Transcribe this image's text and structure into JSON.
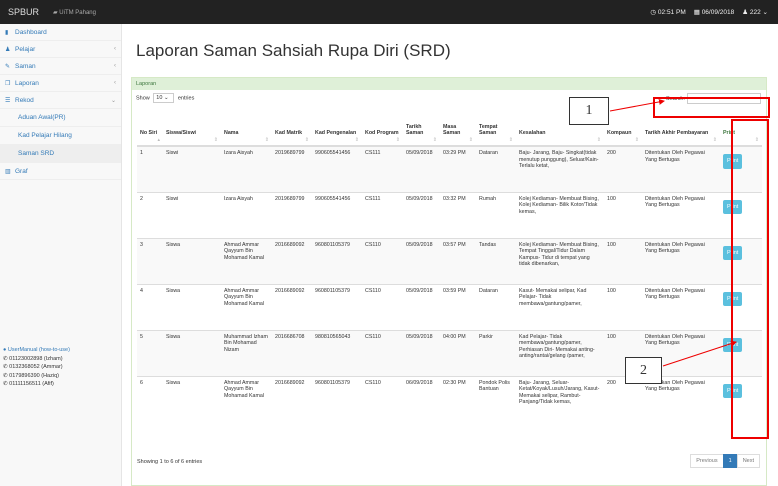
{
  "topbar": {
    "brand": "SPBUR",
    "sub": "UiTM Pahang",
    "time": "02:51 PM",
    "date": "06/09/2018",
    "user": "222"
  },
  "sidebar": {
    "items": [
      {
        "label": "Dashboard",
        "icon": "bookmark-icon",
        "chev": ""
      },
      {
        "label": "Pelajar",
        "icon": "users-icon",
        "chev": "‹"
      },
      {
        "label": "Saman",
        "icon": "edit-icon",
        "chev": "‹"
      },
      {
        "label": "Laporan",
        "icon": "copy-icon",
        "chev": "‹"
      },
      {
        "label": "Rekod",
        "icon": "list-icon",
        "chev": "⌄"
      }
    ],
    "subitems": [
      "Aduan Awal(PR)",
      "Kad Pelajar Hilang",
      "Saman SRD"
    ],
    "graf": "Graf"
  },
  "help": {
    "manual": "UserManual (how-to-use)",
    "contacts": [
      "01123002898 (Izham)",
      "0132368052 (Ammar)",
      "0179896390 (Haziq)",
      "01111156511 (Afif)"
    ]
  },
  "page": {
    "title": "Laporan Saman Sahsiah Rupa Diri (SRD)",
    "panel": "Laporan",
    "show": "Show",
    "entries_sel": "10",
    "entries": "entries",
    "search": "Search:",
    "info": "Showing 1 to 6 of 6 entries",
    "prev": "Previous",
    "page_no": "1",
    "next": "Next"
  },
  "table": {
    "headers": [
      "No Siri",
      "Siswa/Siswi",
      "Nama",
      "Kad Matrik",
      "Kad Pengenalan",
      "Kod Program",
      "Tarikh Saman",
      "Masa Saman",
      "Tempat Saman",
      "Kesalahan",
      "Kompaun",
      "Tarikh Akhir Pembayaran",
      "Print"
    ],
    "rows": [
      [
        "1",
        "Siswi",
        "Izara Aisyah",
        "2019689799",
        "990605541456",
        "CS111",
        "05/09/2018",
        "03:29 PM",
        "Dataran",
        "Baju- Jarang, Baju- Singkat(tidak menutup punggung), Seluar/Kain- Terlalu ketat,",
        "200",
        "Ditentukan Oleh Pegawai Yang Bertugas",
        "Print"
      ],
      [
        "2",
        "Siswi",
        "Izara Aisyah",
        "2019689799",
        "990605541456",
        "CS111",
        "05/09/2018",
        "03:32 PM",
        "Rumah",
        "Kolej Kediaman- Membuat Bising, Kolej Kediaman- Bilik Kotor/Tidak kemas,",
        "100",
        "Ditentukan Oleh Pegawai Yang Bertugas",
        "Print"
      ],
      [
        "3",
        "Siswa",
        "Ahmad Ammar Qayyum Bin Mohamad Kamal",
        "2016689092",
        "960801105379",
        "CS110",
        "05/09/2018",
        "03:57 PM",
        "Tandas",
        "Kolej Kediaman- Membuat Bising, Tempat Tinggal/Tidur Dalam Kampus- Tidur di tempat yang tidak dibenarkan,",
        "100",
        "Ditentukan Oleh Pegawai Yang Bertugas",
        "Print"
      ],
      [
        "4",
        "Siswa",
        "Ahmad Ammar Qayyum Bin Mohamad Kamal",
        "2016689092",
        "960801105379",
        "CS110",
        "05/09/2018",
        "03:59 PM",
        "Dataran",
        "Kasut- Memakai selipar, Kad Pelajar- Tidak membawa/gantung/pamer,",
        "100",
        "Ditentukan Oleh Pegawai Yang Bertugas",
        "Print"
      ],
      [
        "5",
        "Siswa",
        "Muhammad Izham Bin Mohamad Nizam",
        "2016686708",
        "980810565043",
        "CS110",
        "05/09/2018",
        "04:00 PM",
        "Parkir",
        "Kad Pelajar- Tidak membawa/gantung/pamer, Perhiasan Diri- Memakai anting-anting/rantai/gelang /pamer,",
        "100",
        "Ditentukan Oleh Pegawai Yang Bertugas",
        "Print"
      ],
      [
        "6",
        "Siswa",
        "Ahmad Ammar Qayyum Bin Mohamad Kamal",
        "2016689092",
        "960801105379",
        "CS110",
        "06/09/2018",
        "02:30 PM",
        "Pondok Polis Bantuan",
        "Baju- Jarang, Seluar- Ketat/Koyak/Lusuh/Jarang, Kasut- Memakai selipar, Rambut- Panjang/Tidak kemas,",
        "200",
        "Ditentukan Oleh Pegawai Yang Bertugas",
        "Print"
      ]
    ]
  },
  "callouts": [
    "1",
    "2"
  ]
}
